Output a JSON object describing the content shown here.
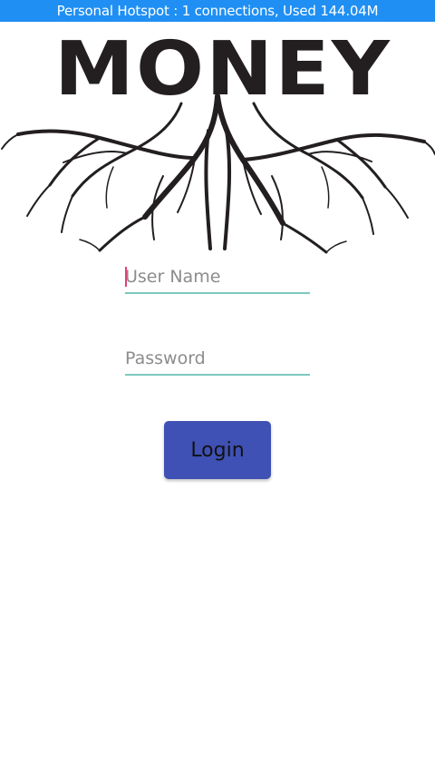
{
  "status_bar": {
    "text": "Personal Hotspot : 1 connections, Used 144.04M",
    "color": "#1f8ff3"
  },
  "logo": {
    "text": "MONEY",
    "icon": "money-roots-logo"
  },
  "form": {
    "username": {
      "value": "",
      "placeholder": "User Name"
    },
    "password": {
      "value": "",
      "placeholder": "Password"
    },
    "login_label": "Login",
    "accent": "#3f51b5",
    "underline": "#7cc8c0"
  }
}
